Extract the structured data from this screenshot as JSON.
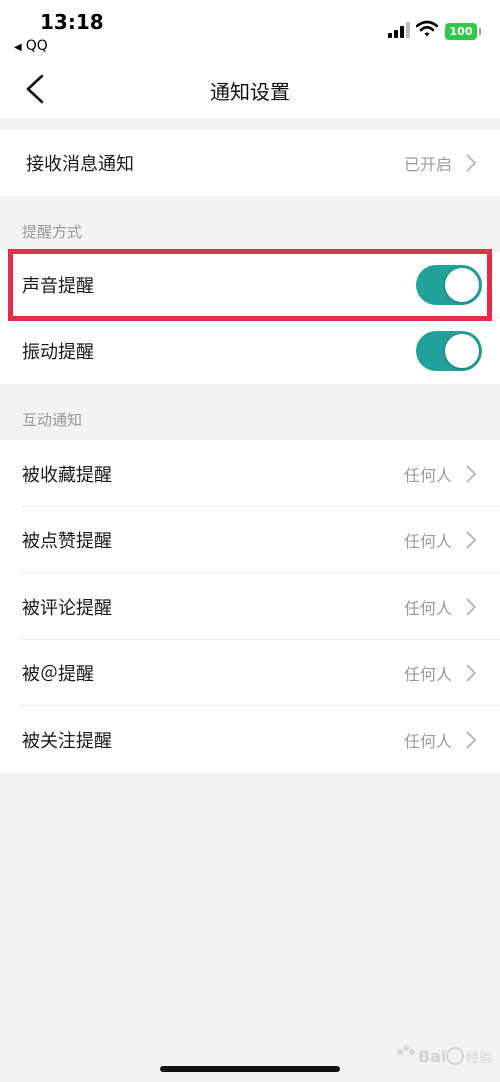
{
  "status_bar": {
    "time": "13:18",
    "back_app": "QQ",
    "battery": "100"
  },
  "nav": {
    "title": "通知设置"
  },
  "receive_row": {
    "label": "接收消息通知",
    "value": "已开启"
  },
  "reminder_section": {
    "title": "提醒方式",
    "items": [
      {
        "label": "声音提醒",
        "enabled": true
      },
      {
        "label": "振动提醒",
        "enabled": true
      }
    ]
  },
  "interaction_section": {
    "title": "互动通知",
    "items": [
      {
        "label": "被收藏提醒",
        "value": "任何人"
      },
      {
        "label": "被点赞提醒",
        "value": "任何人"
      },
      {
        "label": "被评论提醒",
        "value": "任何人"
      },
      {
        "label": "被＠提醒",
        "value": "任何人"
      },
      {
        "label": "被关注提醒",
        "value": "任何人"
      }
    ]
  },
  "colors": {
    "toggle_on": "#21a199",
    "highlight": "#e3304a",
    "battery": "#2fc84b"
  },
  "watermark": "Baidu经验"
}
